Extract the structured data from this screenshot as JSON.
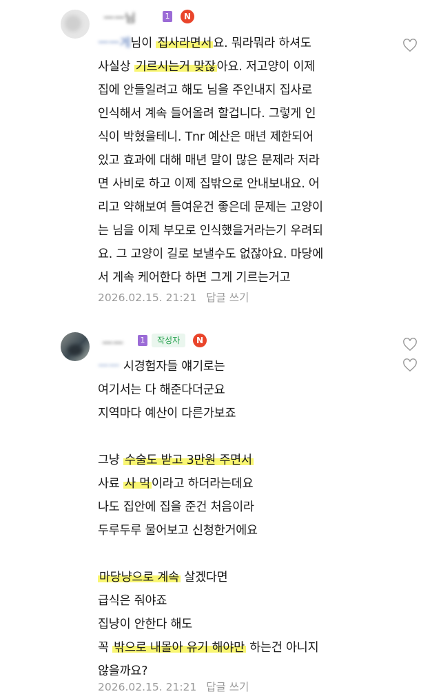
{
  "comments": [
    {
      "nickname": "ㅡㅡ님",
      "level": "1",
      "badge": "N",
      "lines": [
        {
          "blurred": "ㅡㅡ게",
          "rest_before": "님이 집사라면서요. 뭐라뭐라 하셔도"
        },
        {
          "text": "사실상 기르시는거 맞잖아요. 저고양이 이제"
        },
        {
          "text": "집에 안들일려고 해도 님을 주인내지 집사로"
        },
        {
          "text": "인식해서 계속 들어올려 할겁니다. 그렇게 인"
        },
        {
          "text": "식이 박혔을테니. Tnr 예산은 매년 제한되어"
        },
        {
          "text": "있고 효과에 대해 매년 말이 많은 문제라 저라"
        },
        {
          "text": "면 사비로 하고 이제 집밖으로 안내보내요. 어"
        },
        {
          "text": "리고 약해보여 들여운건 좋은데 문제는 고양이"
        },
        {
          "text": "는 님을 이제 부모로 인식했을거라는기 우려되"
        },
        {
          "text": "요. 그 고양이 길로 보낼수도 없잖아요. 마당에"
        },
        {
          "text": "서 게속 케어한다 하면 그게 기르는거고"
        }
      ],
      "hl_line1": "기르시는거 맞잖",
      "line1_pre": "사실상 ",
      "line1_post": "아요. 저고양이 이제",
      "line0_pre": "님이 ",
      "line0_hl": "집사라면서",
      "line0_post": "요. 뭐라뭐라 하셔도",
      "timestamp": "2026.02.15. 21:21",
      "reply_label": "답글 쓰기"
    },
    {
      "nickname": "ㅡㅡ",
      "level": "1",
      "author_tag": "작성자",
      "badge": "N",
      "mention": "ㅡㅡ",
      "l0_rest": "경험자들 얘기로는",
      "l1": "여기서는 다 해준다더군요",
      "l2": "지역마다 예산이 다른가보죠",
      "l3_pre": "그냥 ",
      "l3_hl": "수술도 받고 3만원 주면서",
      "l4_pre": "사료 ",
      "l4_hl": "사 먹",
      "l4_post": "이라고 하더라는데요",
      "l5": "나도 집안에 집을 준건 처음이라",
      "l6": "두루두루 물어보고 신청한거에요",
      "l7_hl": "마당냥으로 계속",
      "l7_post": " 살겠다면",
      "l8": "급식은 줘야죠",
      "l9": "집냥이 안한다 해도",
      "l10_pre": "꼭 ",
      "l10_hl": "밖으로 내몰아 유기 해야만",
      "l10_post": " 하는건 아니지",
      "l11": "않을까요?",
      "timestamp": "2026.02.15. 21:21",
      "reply_label": "답글 쓰기"
    }
  ],
  "icons": {
    "like": "heart-outline-icon",
    "avatar": "user-avatar"
  },
  "colors": {
    "highlight": "#f8f55a",
    "badge_n": "#e9452b",
    "author_tag": "#22a04b",
    "level": "#9b6bd6",
    "meta": "#9a9a9a"
  }
}
